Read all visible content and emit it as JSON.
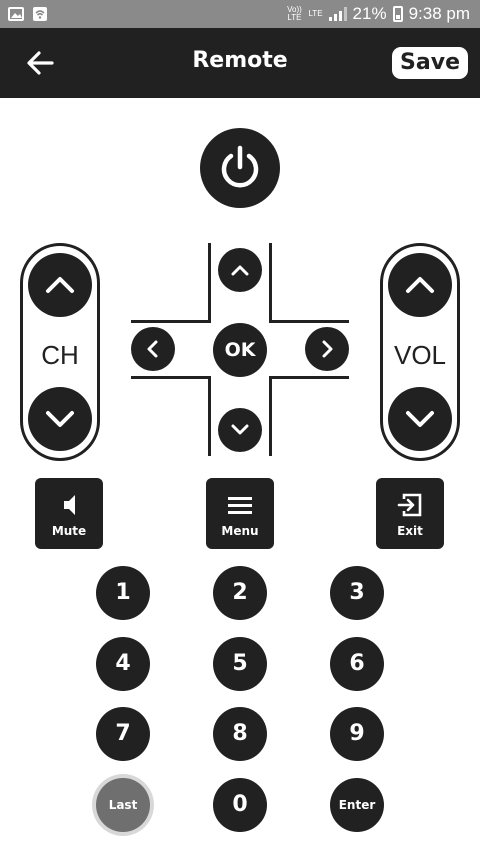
{
  "status_bar": {
    "volte_label": "Vo)) LTE",
    "lte_label": "LTE",
    "battery": "21%",
    "time": "9:38 pm"
  },
  "app_bar": {
    "title": "Remote",
    "save_label": "Save"
  },
  "channel": {
    "label": "CH"
  },
  "volume": {
    "label": "VOL"
  },
  "dpad": {
    "ok_label": "OK"
  },
  "functions": {
    "mute_label": "Mute",
    "menu_label": "Menu",
    "exit_label": "Exit"
  },
  "numpad": {
    "keys": [
      "1",
      "2",
      "3",
      "4",
      "5",
      "6",
      "7",
      "8",
      "9",
      "Last",
      "0",
      "Enter"
    ]
  },
  "colors": {
    "app_bar": "#212121",
    "button": "#212121",
    "status_bar": "#8a8a8a",
    "background": "#ffffff"
  }
}
